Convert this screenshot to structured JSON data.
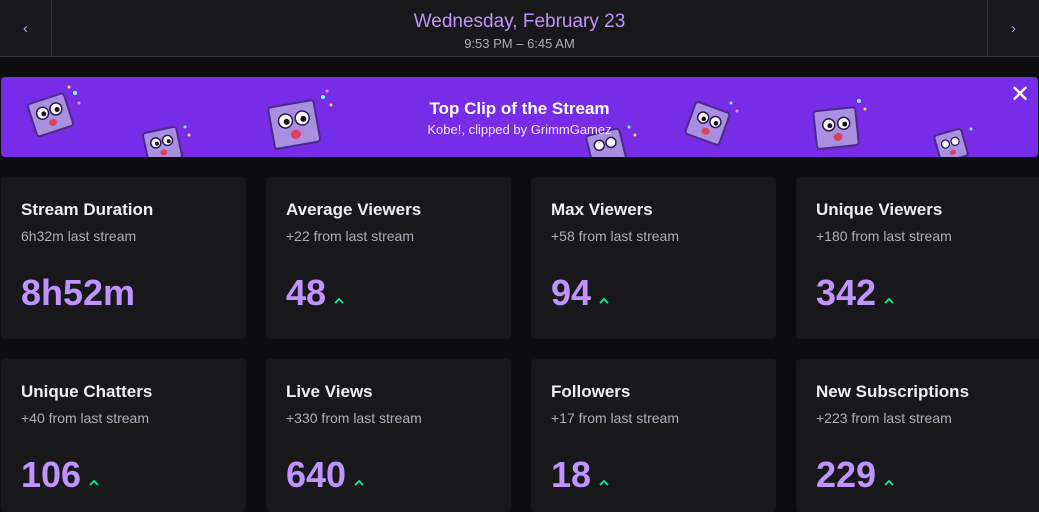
{
  "header": {
    "prev_label": "‹",
    "next_label": "›",
    "date": "Wednesday, February 23",
    "time_range": "9:53 PM – 6:45 AM"
  },
  "banner": {
    "title": "Top Clip of the Stream",
    "subtitle": "Kobe!, clipped by GrimmGamez",
    "close_label": "✕",
    "background": "#772ce8"
  },
  "stats": [
    {
      "title": "Stream Duration",
      "subtitle": "6h32m last stream",
      "value": "8h52m",
      "trend": "none"
    },
    {
      "title": "Average Viewers",
      "subtitle": "+22 from last stream",
      "value": "48",
      "trend": "up"
    },
    {
      "title": "Max Viewers",
      "subtitle": "+58 from last stream",
      "value": "94",
      "trend": "up"
    },
    {
      "title": "Unique Viewers",
      "subtitle": "+180 from last stream",
      "value": "342",
      "trend": "up"
    },
    {
      "title": "Unique Chatters",
      "subtitle": "+40 from last stream",
      "value": "106",
      "trend": "up"
    },
    {
      "title": "Live Views",
      "subtitle": "+330 from last stream",
      "value": "640",
      "trend": "up"
    },
    {
      "title": "Followers",
      "subtitle": "+17 from last stream",
      "value": "18",
      "trend": "up"
    },
    {
      "title": "New Subscriptions",
      "subtitle": "+223 from last stream",
      "value": "229",
      "trend": "up"
    }
  ],
  "colors": {
    "accent": "#bf94ff",
    "trend_up": "#00f593",
    "card_bg": "#18181b",
    "page_bg": "#0e0e10"
  }
}
